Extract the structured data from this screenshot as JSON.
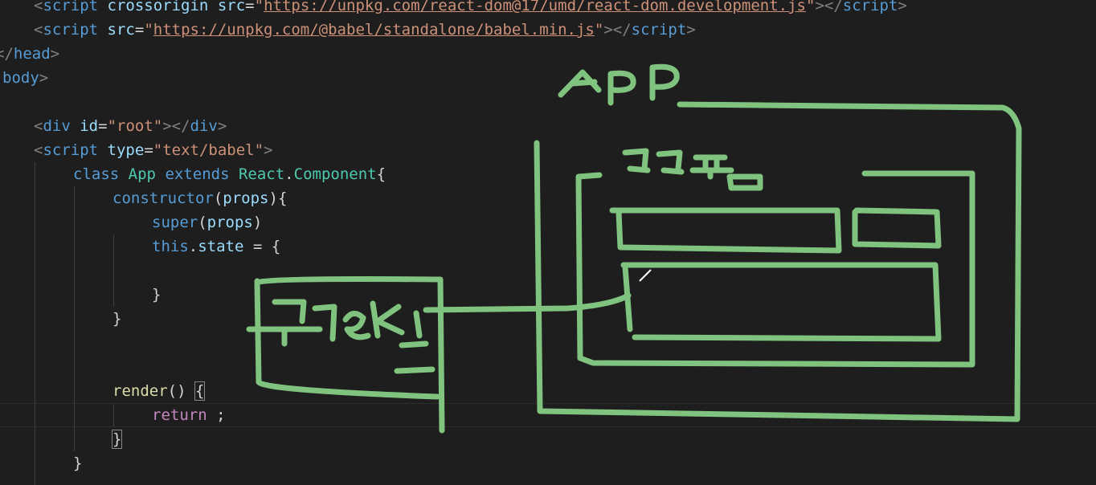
{
  "code": {
    "line1": {
      "indent": "  ",
      "open": "<",
      "tag": "script",
      "attr1": "crossorigin",
      "attr2": "src",
      "eq": "=",
      "q1": "\"",
      "url": "https://unpkg.com/react-dom@17/umd/react-dom.development.js",
      "q2": "\"",
      "close": "></",
      "tag_end": "script",
      "gt": ">"
    },
    "line2": {
      "indent": "  ",
      "open": "<",
      "tag": "script",
      "attr": "src",
      "eq": "=",
      "q1": "\"",
      "url": "https://unpkg.com/@babel/standalone/babel.min.js",
      "q2": "\"",
      "close": "></",
      "tag_end": "script",
      "gt": ">"
    },
    "line3": {
      "open": "</",
      "tag": "head",
      "gt": ">"
    },
    "line4": {
      "tag": "body",
      "gt": ">"
    },
    "line6": {
      "open": "<",
      "tag": "div",
      "attr": "id",
      "eq": "=",
      "str": "\"root\"",
      "close": "></",
      "tag_end": "div",
      "gt": ">"
    },
    "line7": {
      "open": "<",
      "tag": "script",
      "attr": "type",
      "eq": "=",
      "str": "\"text/babel\"",
      "gt": ">"
    },
    "line8": {
      "kw1": "class",
      "name": "App",
      "kw2": "extends",
      "base1": "React",
      "dot": ".",
      "base2": "Component",
      "brace": "{"
    },
    "line9": {
      "fn": "constructor",
      "p1": "(",
      "param": "props",
      "p2": "){"
    },
    "line10": {
      "fn": "super",
      "p1": "(",
      "param": "props",
      "p2": ")"
    },
    "line11": {
      "kw": "this",
      "dot": ".",
      "prop": "state",
      "rest": " = {"
    },
    "line13": {
      "text": "}"
    },
    "line14": {
      "text": "}"
    },
    "line17": {
      "fn": "render",
      "parens": "() ",
      "brace": "{"
    },
    "line18": {
      "kw": "return",
      "rest": " ;"
    },
    "line19": {
      "text": "}"
    },
    "line20": {
      "text": "}"
    }
  },
  "annotations": {
    "app_label": "APP",
    "form_label": "구구폼",
    "table_label": "구구aKE",
    "stroke_color": "#7fc37f"
  }
}
